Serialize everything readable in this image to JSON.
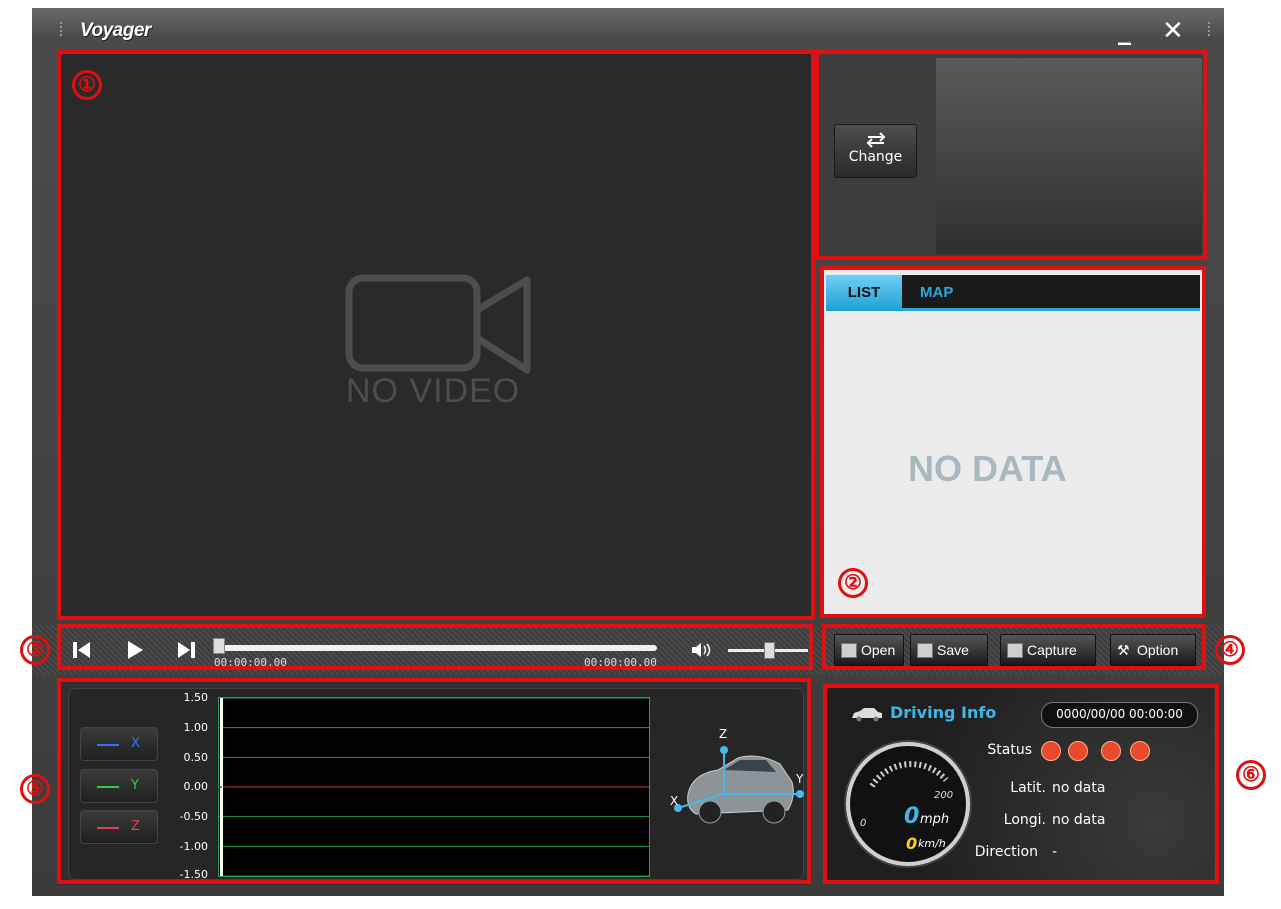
{
  "window": {
    "title": "Voyager",
    "minimize_label": "_",
    "close_label": "✕"
  },
  "annotations": [
    "①",
    "②",
    "③",
    "④",
    "⑤",
    "⑥"
  ],
  "video": {
    "placeholder": "NO VIDEO"
  },
  "sub_view": {
    "change_label": "Change"
  },
  "side_tabs": [
    {
      "label": "LIST",
      "active": true
    },
    {
      "label": "MAP",
      "active": false
    }
  ],
  "list": {
    "empty_text": "NO DATA"
  },
  "player": {
    "time_start": "00:00:00.00",
    "time_end": "00:00:00.00",
    "progress": 0.0,
    "volume": 0.5
  },
  "toolbar": {
    "open_label": "Open",
    "save_label": "Save",
    "capture_label": "Capture",
    "option_label": "Option"
  },
  "gsensor": {
    "axes": [
      {
        "label": "X",
        "color": "#3a6cff"
      },
      {
        "label": "Y",
        "color": "#33cc44"
      },
      {
        "label": "Z",
        "color": "#e0405a"
      }
    ],
    "y_ticks": [
      "1.50",
      "1.00",
      "0.50",
      "0.00",
      "-0.50",
      "-1.00",
      "-1.50"
    ],
    "car_axis_labels": [
      "Z",
      "X",
      "Y"
    ]
  },
  "chart_data": {
    "type": "line",
    "ylim": [
      -1.5,
      1.5
    ],
    "y_ticks": [
      1.5,
      1.0,
      0.5,
      0.0,
      -0.5,
      -1.0,
      -1.5
    ],
    "series": [
      {
        "name": "X",
        "values": [
          0.0
        ]
      },
      {
        "name": "Y",
        "values": [
          0.0
        ]
      },
      {
        "name": "Z",
        "values": [
          0.0
        ]
      }
    ],
    "grid": true
  },
  "driving": {
    "title": "Driving Info",
    "datetime": "0000/00/00 00:00:00",
    "status_label": "Status",
    "lat_label": "Latit.",
    "lat_value": "no data",
    "lon_label": "Longi.",
    "lon_value": "no data",
    "dir_label": "Direction",
    "dir_value": "-",
    "speed_mph": "0",
    "speed_kmh": "0",
    "mph_unit": "mph",
    "kmh_unit": "km/h",
    "gauge_max": "200",
    "gauge_min": "0"
  }
}
